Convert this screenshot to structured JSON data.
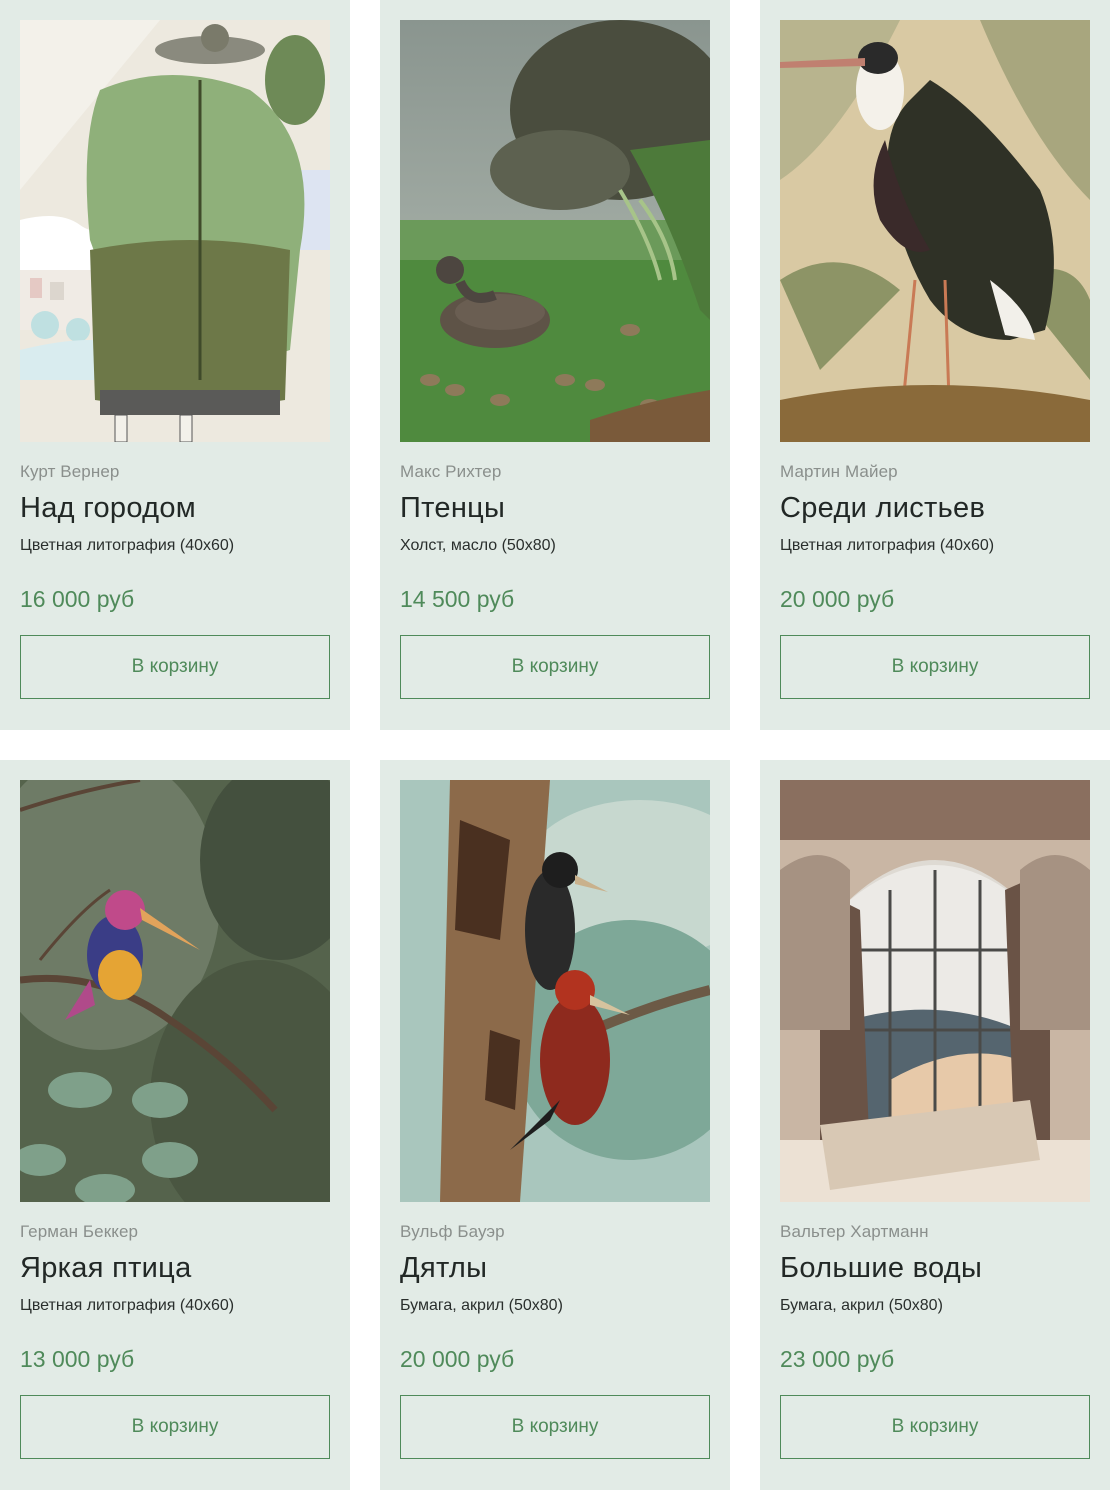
{
  "products": [
    {
      "artist": "Курт Вернер",
      "title": "Над городом",
      "medium": "Цветная литография (40x60)",
      "price": "16 000 руб",
      "button_label": "В корзину",
      "image_alt": "woman-in-green-coat-artwork"
    },
    {
      "artist": "Макс Рихтер",
      "title": "Птенцы",
      "medium": "Холст, масло (50x80)",
      "price": "14 500 руб",
      "button_label": "В корзину",
      "image_alt": "quail-with-chicks-artwork"
    },
    {
      "artist": "Мартин Майер",
      "title": "Среди листьев",
      "medium": "Цветная литография (40x60)",
      "price": "20 000 руб",
      "button_label": "В корзину",
      "image_alt": "stork-among-leaves-artwork"
    },
    {
      "artist": "Герман Беккер",
      "title": "Яркая птица",
      "medium": "Цветная литография (40x60)",
      "price": "13 000 руб",
      "button_label": "В корзину",
      "image_alt": "kingfisher-artwork"
    },
    {
      "artist": "Вульф Бауэр",
      "title": "Дятлы",
      "medium": "Бумага, акрил (50x80)",
      "price": "20 000 руб",
      "button_label": "В корзину",
      "image_alt": "woodpeckers-artwork"
    },
    {
      "artist": "Вальтер Хартманн",
      "title": "Большие воды",
      "medium": "Бумага, акрил (50x80)",
      "price": "23 000 руб",
      "button_label": "В корзину",
      "image_alt": "window-view-artwork"
    }
  ],
  "colors": {
    "card_background": "#e2ebe6",
    "accent_green": "#4f8a5a",
    "artist_gray": "#8a8f8c",
    "title_dark": "#222826"
  }
}
